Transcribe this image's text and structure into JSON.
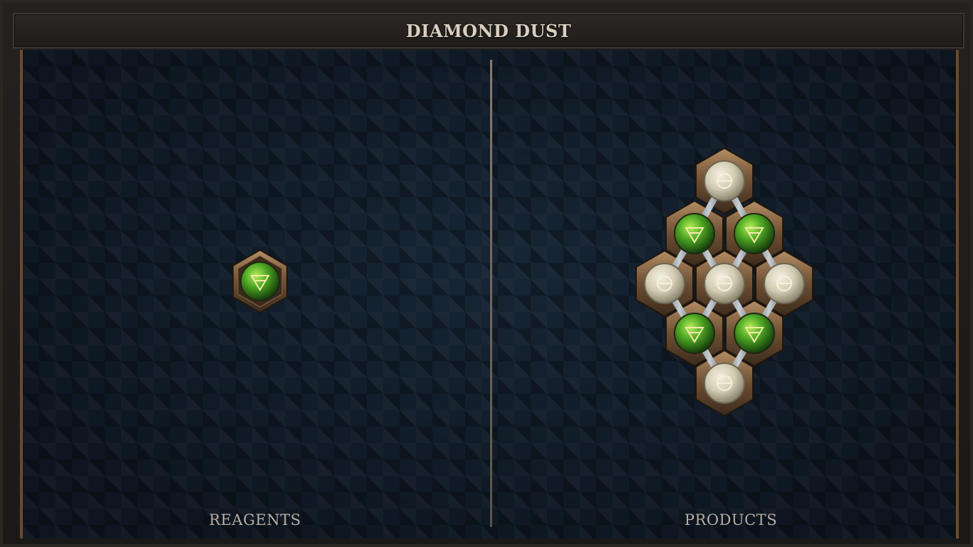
{
  "title": "DIAMOND DUST",
  "reagents": {
    "label": "REAGENTS",
    "items": [
      {
        "type": "earth",
        "glyph": "earth-icon"
      }
    ]
  },
  "products": {
    "label": "PRODUCTS",
    "structure": [
      {
        "type": "salt",
        "glyph": "salt-icon"
      },
      {
        "type": "earth",
        "glyph": "earth-icon"
      },
      {
        "type": "earth",
        "glyph": "earth-icon"
      },
      {
        "type": "salt",
        "glyph": "salt-icon"
      },
      {
        "type": "salt",
        "glyph": "salt-icon"
      },
      {
        "type": "salt",
        "glyph": "salt-icon"
      },
      {
        "type": "earth",
        "glyph": "earth-icon"
      },
      {
        "type": "earth",
        "glyph": "earth-icon"
      },
      {
        "type": "salt",
        "glyph": "salt-icon"
      }
    ]
  },
  "colors": {
    "earth": "#4fa824",
    "salt": "#d9d3bd",
    "frame_bronze": "#8a6a48"
  }
}
